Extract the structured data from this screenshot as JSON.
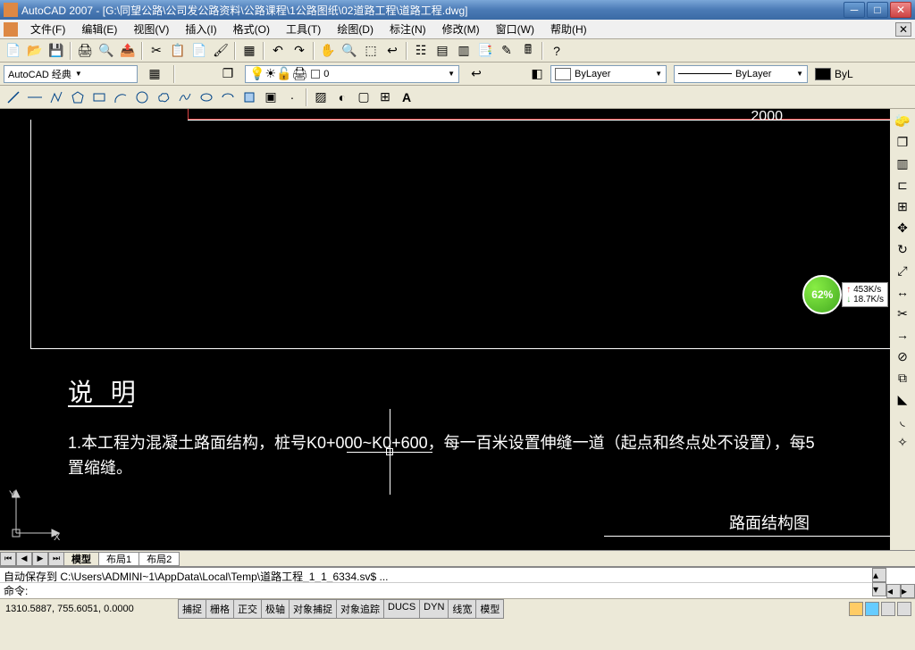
{
  "titlebar": {
    "app": "AutoCAD 2007",
    "document": "[G:\\同望公路\\公司发公路资料\\公路课程\\1公路图纸\\02道路工程\\道路工程.dwg]"
  },
  "menu": {
    "file": "文件(F)",
    "edit": "编辑(E)",
    "view": "视图(V)",
    "insert": "插入(I)",
    "format": "格式(O)",
    "tools": "工具(T)",
    "draw": "绘图(D)",
    "dimension": "标注(N)",
    "modify": "修改(M)",
    "window": "窗口(W)",
    "help": "帮助(H)"
  },
  "workspace": {
    "name": "AutoCAD 经典",
    "layer_value": "0",
    "bylayer1": "ByLayer",
    "bylayer2": "ByLayer",
    "bylayer3": "ByL"
  },
  "drawing": {
    "dimension": "2000",
    "title": "说 明",
    "line1": "1.本工程为混凝土路面结构，桩号K0+000~K0+600，每一百米设置伸缝一道（起点和终点处不设置），每5",
    "line2": "置缩缝。",
    "subtitle": "路面结构图",
    "ucs_x": "X",
    "ucs_y": "Y"
  },
  "net": {
    "percent": "62%",
    "up": "453K/s",
    "down": "18.7K/s"
  },
  "tabs": {
    "model": "模型",
    "layout1": "布局1",
    "layout2": "布局2"
  },
  "cmdline": {
    "history": "自动保存到 C:\\Users\\ADMINI~1\\AppData\\Local\\Temp\\道路工程_1_1_6334.sv$ ...",
    "prompt": "命令:"
  },
  "status": {
    "coords": "1310.5887, 755.6051, 0.0000",
    "snap": "捕捉",
    "grid": "栅格",
    "ortho": "正交",
    "polar": "极轴",
    "osnap": "对象捕捉",
    "otrack": "对象追踪",
    "ducs": "DUCS",
    "dyn": "DYN",
    "lwt": "线宽",
    "model": "模型"
  }
}
